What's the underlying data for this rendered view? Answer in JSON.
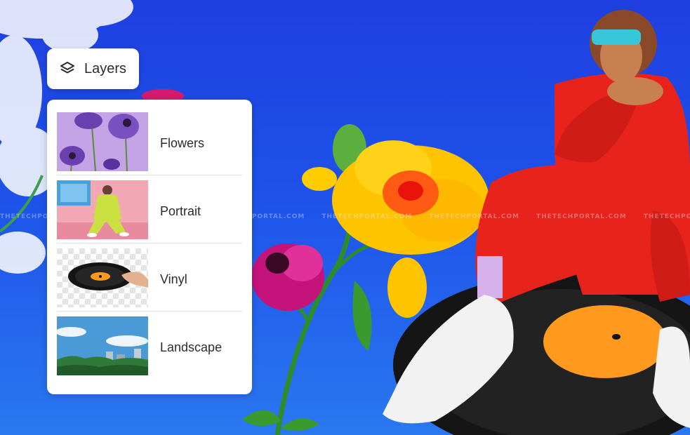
{
  "header": {
    "title": "Layers",
    "icon": "layers-icon"
  },
  "layers": [
    {
      "name": "Flowers",
      "thumb": "purple-flowers"
    },
    {
      "name": "Portrait",
      "thumb": "portrait-photo"
    },
    {
      "name": "Vinyl",
      "thumb": "vinyl-record"
    },
    {
      "name": "Landscape",
      "thumb": "city-landscape"
    }
  ],
  "watermark": "THETECHPORTAL.COM",
  "colors": {
    "sky": "#1e52ea",
    "panel": "#ffffff",
    "text": "#2c2c2c",
    "divider": "#e2e2e2",
    "outfit_red": "#e8231c",
    "flower_yellow": "#ffc800",
    "flower_magenta": "#c4137a",
    "record_label": "#ff9a1e"
  }
}
